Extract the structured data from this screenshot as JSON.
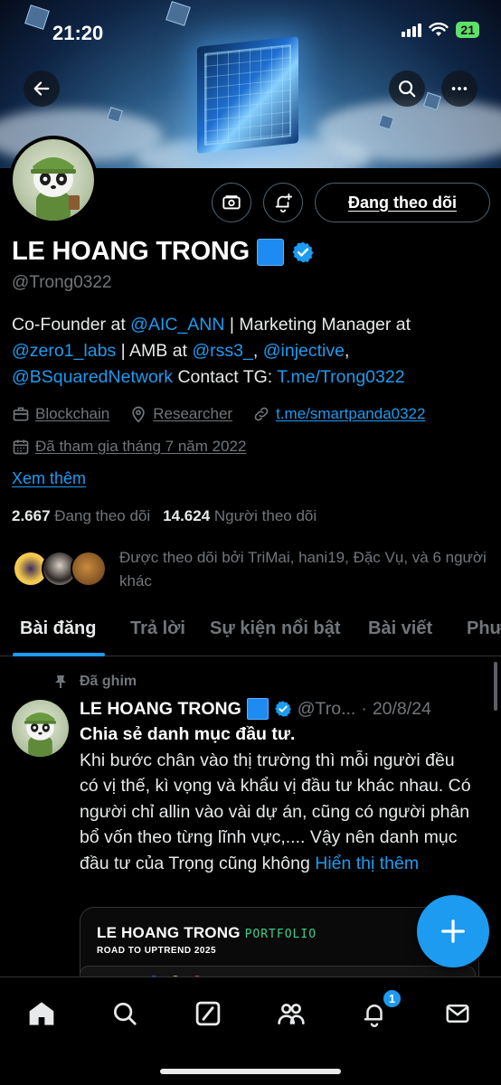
{
  "status_bar": {
    "time": "21:20",
    "battery": "21"
  },
  "profile": {
    "display_name": "LE HOANG TRONG",
    "handle": "@Trong0322",
    "follow_button_label": "Đang theo dõi",
    "bio": {
      "t1": "Co-Founder at ",
      "l1": "@AIC_ANN",
      "t2": " | Marketing Manager at ",
      "l2": "@zero1_labs",
      "t3": " | AMB at ",
      "l3": "@rss3_",
      "t4": ", ",
      "l4": "@injective",
      "t5": ",",
      "l5": "@BSquaredNetwork",
      "t6": " Contact TG: ",
      "l6": "T.me/Trong0322"
    },
    "category": "Blockchain",
    "location": "Researcher",
    "website": "t.me/smartpanda0322",
    "joined": "Đã tham gia tháng 7 năm 2022",
    "see_more": "Xem thêm",
    "following_count": "2.667",
    "following_label": "Đang theo dõi",
    "followers_count": "14.624",
    "followers_label": "Người theo dõi",
    "followed_by": "Được theo dõi bởi TriMai, hani19, Đặc Vụ, và 6 người khác"
  },
  "tabs": [
    "Bài đăng",
    "Trả lời",
    "Sự kiện nổi bật",
    "Bài viết",
    "Phư"
  ],
  "pinned_tweet": {
    "pinned_label": "Đã ghim",
    "author_name": "LE HOANG TRONG",
    "author_handle": "@Tro...",
    "dot": "·",
    "date": "20/8/24",
    "title": "Chia sẻ danh mục đầu tư.",
    "body": "Khi bước chân vào thị trường thì mỗi người đều có vị thế, kì vọng và khẩu vị đầu tư khác nhau. Có người chỉ allin vào vài dự án, cũng có người phân bổ vốn theo từng lĩnh vực,.... Vậy nên danh mục đầu tư của Trọng cũng không ",
    "show_more": "Hiển thị thêm",
    "card_title": "LE HOANG TRONG",
    "card_portfolio": "PORTFOLIO",
    "card_subtitle": "ROAD TO UPTREND 2025"
  },
  "bottom_nav": {
    "items": [
      "home-icon",
      "search-icon",
      "grok-icon",
      "communities-icon",
      "notifications-icon",
      "messages-icon"
    ],
    "notification_count": "1"
  },
  "colors": {
    "accent": "#1d9bf0",
    "background": "#000000",
    "muted": "#71767b"
  }
}
